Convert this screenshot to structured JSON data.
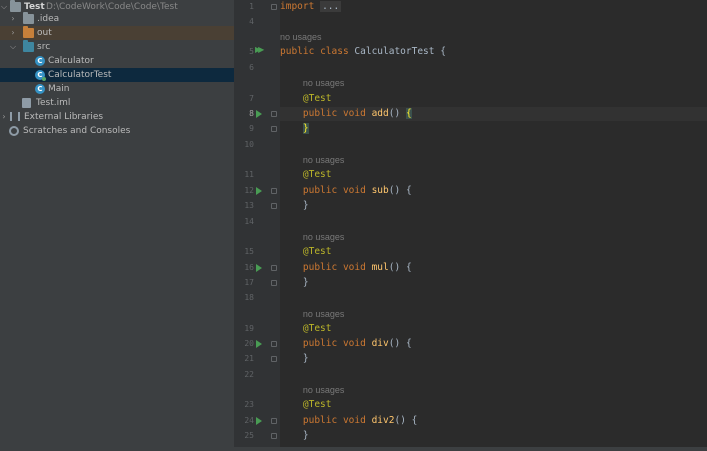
{
  "tree": {
    "project_name": "Test",
    "project_path": "D:\\CodeWork\\Code\\Code\\Test",
    "items": [
      {
        "label": "Test"
      },
      {
        "label": ".idea"
      },
      {
        "label": "out"
      },
      {
        "label": "src"
      },
      {
        "label": "Calculator"
      },
      {
        "label": "CalculatorTest"
      },
      {
        "label": "Main"
      },
      {
        "label": "Test.iml"
      },
      {
        "label": "External Libraries"
      },
      {
        "label": "Scratches and Consoles"
      }
    ]
  },
  "editor": {
    "code": {
      "import_kw": "import",
      "import_dots": "...",
      "no_usages": "no usages",
      "public": "public",
      "class": "class",
      "class_name": "CalculatorTest",
      "open_brace": "{",
      "close_brace": "}",
      "annotation": "@Test",
      "void": "void",
      "parens": "()",
      "methods": [
        "add",
        "sub",
        "mul",
        "div",
        "div2"
      ]
    },
    "line_numbers": [
      "1",
      "4",
      "5",
      "6",
      "7",
      "8",
      "9",
      "10",
      "11",
      "12",
      "13",
      "14",
      "15",
      "16",
      "17",
      "18",
      "19",
      "20",
      "21",
      "22",
      "23",
      "24",
      "25"
    ]
  },
  "colors": {
    "keyword": "#cc7832",
    "annotation": "#bbb529",
    "method": "#ffc66d",
    "run_icon": "#499c54",
    "selection": "#0d293e"
  }
}
